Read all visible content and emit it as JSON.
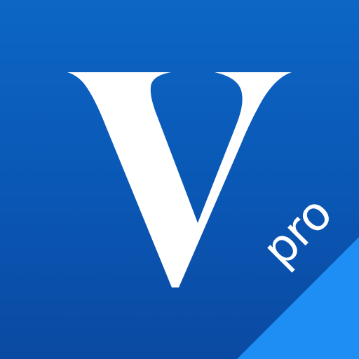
{
  "app_icon": {
    "logo_letter": "V",
    "badge_text": "pro"
  },
  "colors": {
    "background_top": "#0d66c4",
    "background_bottom": "#0a4aa2",
    "ribbon": "#1e8ef5",
    "letter": "#ffffff"
  },
  "icons": {
    "logo": "serif-v-logo-icon"
  }
}
